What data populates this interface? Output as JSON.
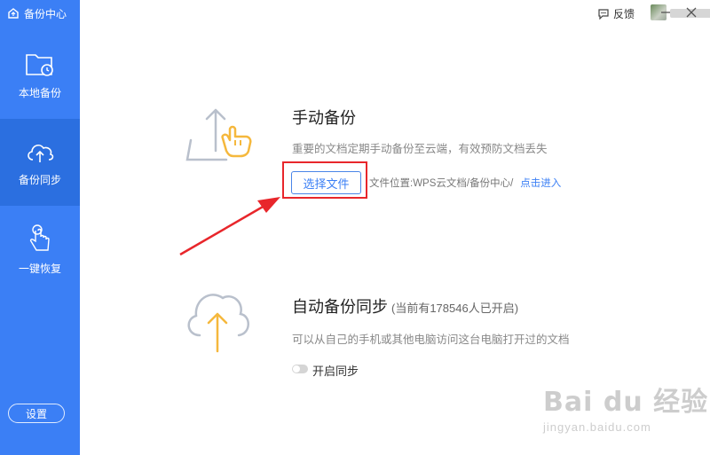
{
  "sidebar": {
    "brand": "备份中心",
    "items": [
      {
        "label": "本地备份",
        "icon": "local-backup-folder-icon"
      },
      {
        "label": "备份同步",
        "icon": "cloud-upload-icon"
      },
      {
        "label": "一键恢复",
        "icon": "tap-hand-icon"
      }
    ],
    "active_index": 1,
    "settings_label": "设置"
  },
  "titlebar": {
    "feedback_label": "反馈"
  },
  "manual": {
    "title": "手动备份",
    "desc": "重要的文档定期手动备份至云端，有效预防文档丢失",
    "button": "选择文件",
    "location": "文件位置:WPS云文档/备份中心/",
    "link": "点击进入"
  },
  "auto": {
    "title": "自动备份同步",
    "note": "(当前有178546人已开启)",
    "desc": "可以从自己的手机或其他电脑访问这台电脑打开过的文档",
    "toggle_label": "开启同步",
    "toggle_on": false
  },
  "watermark": {
    "main": "Bai du 经验",
    "sub": "jingyan.baidu.com"
  },
  "colors": {
    "sidebar": "#3b7ff5",
    "sidebar_active": "#2b6fe0",
    "accent": "#3b7ff5",
    "highlight_red": "#e8262b",
    "illustration_orange": "#f5b83d"
  }
}
